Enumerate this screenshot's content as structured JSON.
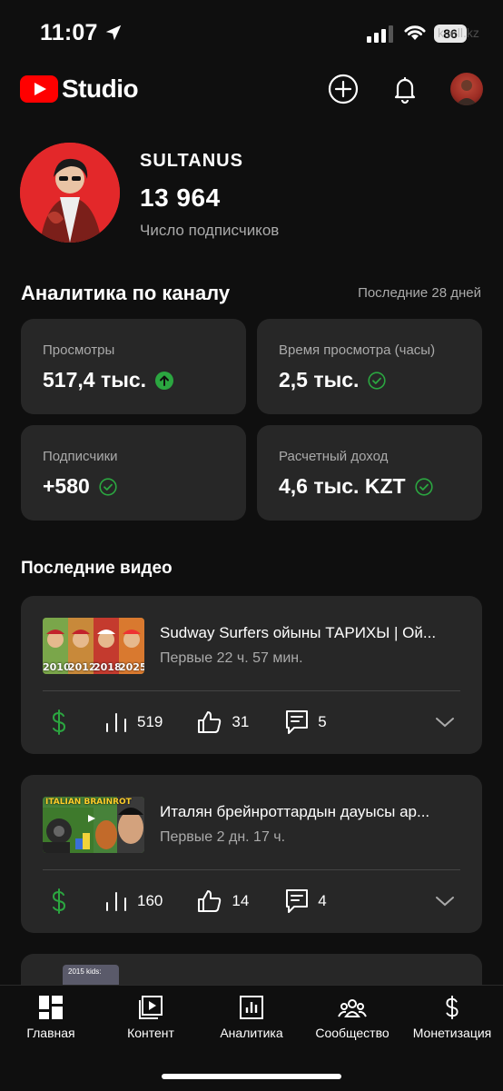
{
  "status_bar": {
    "time": "11:07",
    "battery": "86",
    "carrier": "kcell.kz"
  },
  "header": {
    "logo_text": "Studio",
    "create_icon": "plus-circle-icon",
    "notifications_icon": "bell-icon"
  },
  "channel": {
    "name": "SULTANUS",
    "subscribers": "13 964",
    "subscribers_label": "Число подписчиков"
  },
  "analytics": {
    "title": "Аналитика по каналу",
    "period": "Последние 28 дней",
    "stats": [
      {
        "label": "Просмотры",
        "value": "517,4 тыс.",
        "indicator": "arrow-up-icon"
      },
      {
        "label": "Время просмотра (часы)",
        "value": "2,5 тыс.",
        "indicator": "check-icon"
      },
      {
        "label": "Подписчики",
        "value": "+580",
        "indicator": "check-icon"
      },
      {
        "label": "Расчетный доход",
        "value": "4,6 тыс. KZT",
        "indicator": "check-icon"
      }
    ],
    "colors": {
      "up": "#2ba640",
      "card": "#272727"
    }
  },
  "recent_videos": {
    "title": "Последние видео",
    "items": [
      {
        "title": "Sudway Surfers ойыны ТАРИХЫ | Ой...",
        "subtitle": "Первые 22 ч. 57 мин.",
        "views": "519",
        "likes": "31",
        "comments": "5",
        "thumb_years": [
          "2010",
          "2012",
          "2018",
          "2025"
        ]
      },
      {
        "title": "Италян брейнроттардын дауысы ар...",
        "subtitle": "Первые 2 дн. 17 ч.",
        "views": "160",
        "likes": "14",
        "comments": "4",
        "thumb_text": "ITALIAN BRAINROT"
      },
      {
        "thumb_text": "2015 kids:"
      }
    ]
  },
  "bottom_nav": {
    "items": [
      {
        "label": "Главная",
        "icon": "dashboard-icon"
      },
      {
        "label": "Контент",
        "icon": "content-icon"
      },
      {
        "label": "Аналитика",
        "icon": "analytics-icon"
      },
      {
        "label": "Сообщество",
        "icon": "community-icon"
      },
      {
        "label": "Монетизация",
        "icon": "dollar-icon"
      }
    ]
  }
}
